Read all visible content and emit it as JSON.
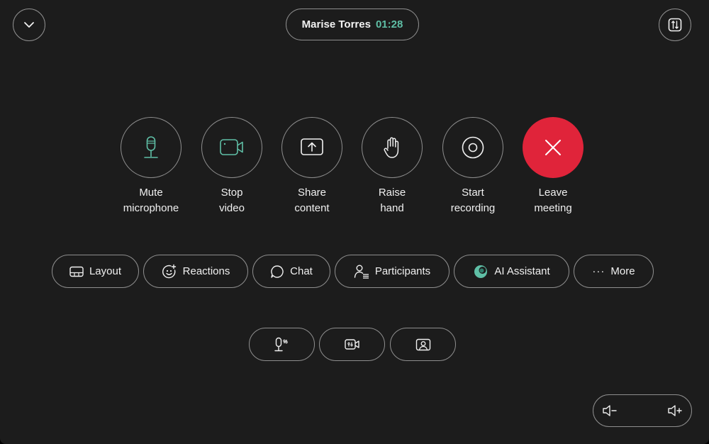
{
  "session": {
    "name": "Marise Torres",
    "timer": "01:28"
  },
  "main_controls": [
    {
      "line1": "Mute",
      "line2": "microphone",
      "icon": "microphone-icon"
    },
    {
      "line1": "Stop",
      "line2": "video",
      "icon": "video-camera-icon"
    },
    {
      "line1": "Share",
      "line2": "content",
      "icon": "share-screen-icon"
    },
    {
      "line1": "Raise",
      "line2": "hand",
      "icon": "hand-icon"
    },
    {
      "line1": "Start",
      "line2": "recording",
      "icon": "record-icon"
    },
    {
      "line1": "Leave",
      "line2": "meeting",
      "icon": "close-icon"
    }
  ],
  "pills": {
    "layout": "Layout",
    "reactions": "Reactions",
    "chat": "Chat",
    "participants": "Participants",
    "ai_assistant": "AI Assistant",
    "more": "More",
    "more_glyph": "···"
  },
  "colors": {
    "background": "#1c1c1c",
    "accent_teal": "#5fbfa6",
    "leave_red": "#e0243a",
    "outline": "#8e8e8e"
  }
}
